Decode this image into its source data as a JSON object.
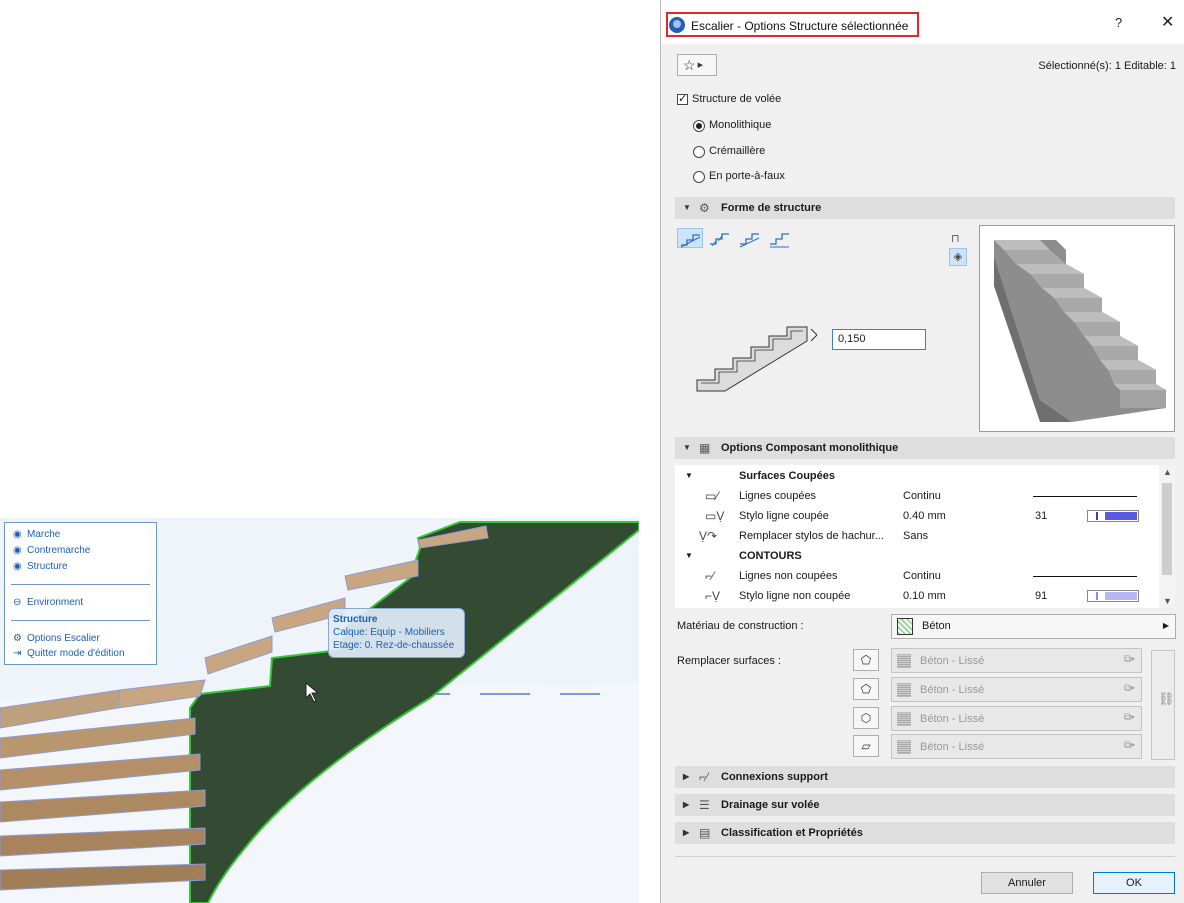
{
  "viewport": {
    "palette": {
      "items": [
        {
          "icon": "eye-icon",
          "label": "Marche"
        },
        {
          "icon": "eye-icon",
          "label": "Contremarche"
        },
        {
          "icon": "eye-icon",
          "label": "Structure"
        },
        {
          "icon": "eye-closed-icon",
          "label": "Environment"
        },
        {
          "icon": "stair-settings-icon",
          "label": "Options Escalier"
        },
        {
          "icon": "exit-icon",
          "label": "Quitter mode d'édition"
        }
      ]
    },
    "info_tag": {
      "line1": "Structure",
      "line2": "Calque: Equip - Mobiliers",
      "line3": "Etage: 0. Rez-de-chaussée"
    }
  },
  "dialog": {
    "title": "Escalier - Options Structure sélectionnée",
    "help": "?",
    "close": "✕",
    "favorites_icon": "star-icon",
    "selection": "Sélectionné(s): 1 Editable: 1",
    "structure_volee": {
      "label": "Structure de volée",
      "checked": true
    },
    "types": [
      {
        "label": "Monolithique",
        "selected": true
      },
      {
        "label": "Crémaillère",
        "selected": false
      },
      {
        "label": "En porte-à-faux",
        "selected": false
      }
    ],
    "forme_section": {
      "title": "Forme de structure",
      "profile_value": "0,150"
    },
    "composant_section": {
      "title": "Options Composant monolithique",
      "rows": [
        {
          "type": "group",
          "label": "Surfaces Coupées"
        },
        {
          "type": "item",
          "icon": "cut-line-icon",
          "label": "Lignes coupées",
          "value": "Continu",
          "extra": "line"
        },
        {
          "type": "item",
          "icon": "cut-pen-icon",
          "label": "Stylo ligne coupée",
          "value": "0.40 mm",
          "num": "31",
          "extra": "swatch"
        },
        {
          "type": "item",
          "icon": "override-pen-icon",
          "label": "Remplacer stylos de hachur...",
          "value": "Sans"
        },
        {
          "type": "group",
          "label": "CONTOURS"
        },
        {
          "type": "item",
          "icon": "uncut-line-icon",
          "label": "Lignes non coupées",
          "value": "Continu",
          "extra": "line"
        },
        {
          "type": "item",
          "icon": "uncut-pen-icon",
          "label": "Stylo ligne non coupée",
          "value": "0.10 mm",
          "num": "91",
          "extra": "swatch-light"
        }
      ]
    },
    "materiau": {
      "label": "Matériau de construction :",
      "value": "Béton"
    },
    "surfaces": {
      "label": "Remplacer surfaces :",
      "items": [
        "Béton - Lissé",
        "Béton - Lissé",
        "Béton - Lissé",
        "Béton - Lissé"
      ]
    },
    "collapsed_sections": [
      "Connexions support",
      "Drainage sur volée",
      "Classification et Propriétés"
    ],
    "buttons": {
      "cancel": "Annuler",
      "ok": "OK"
    }
  }
}
